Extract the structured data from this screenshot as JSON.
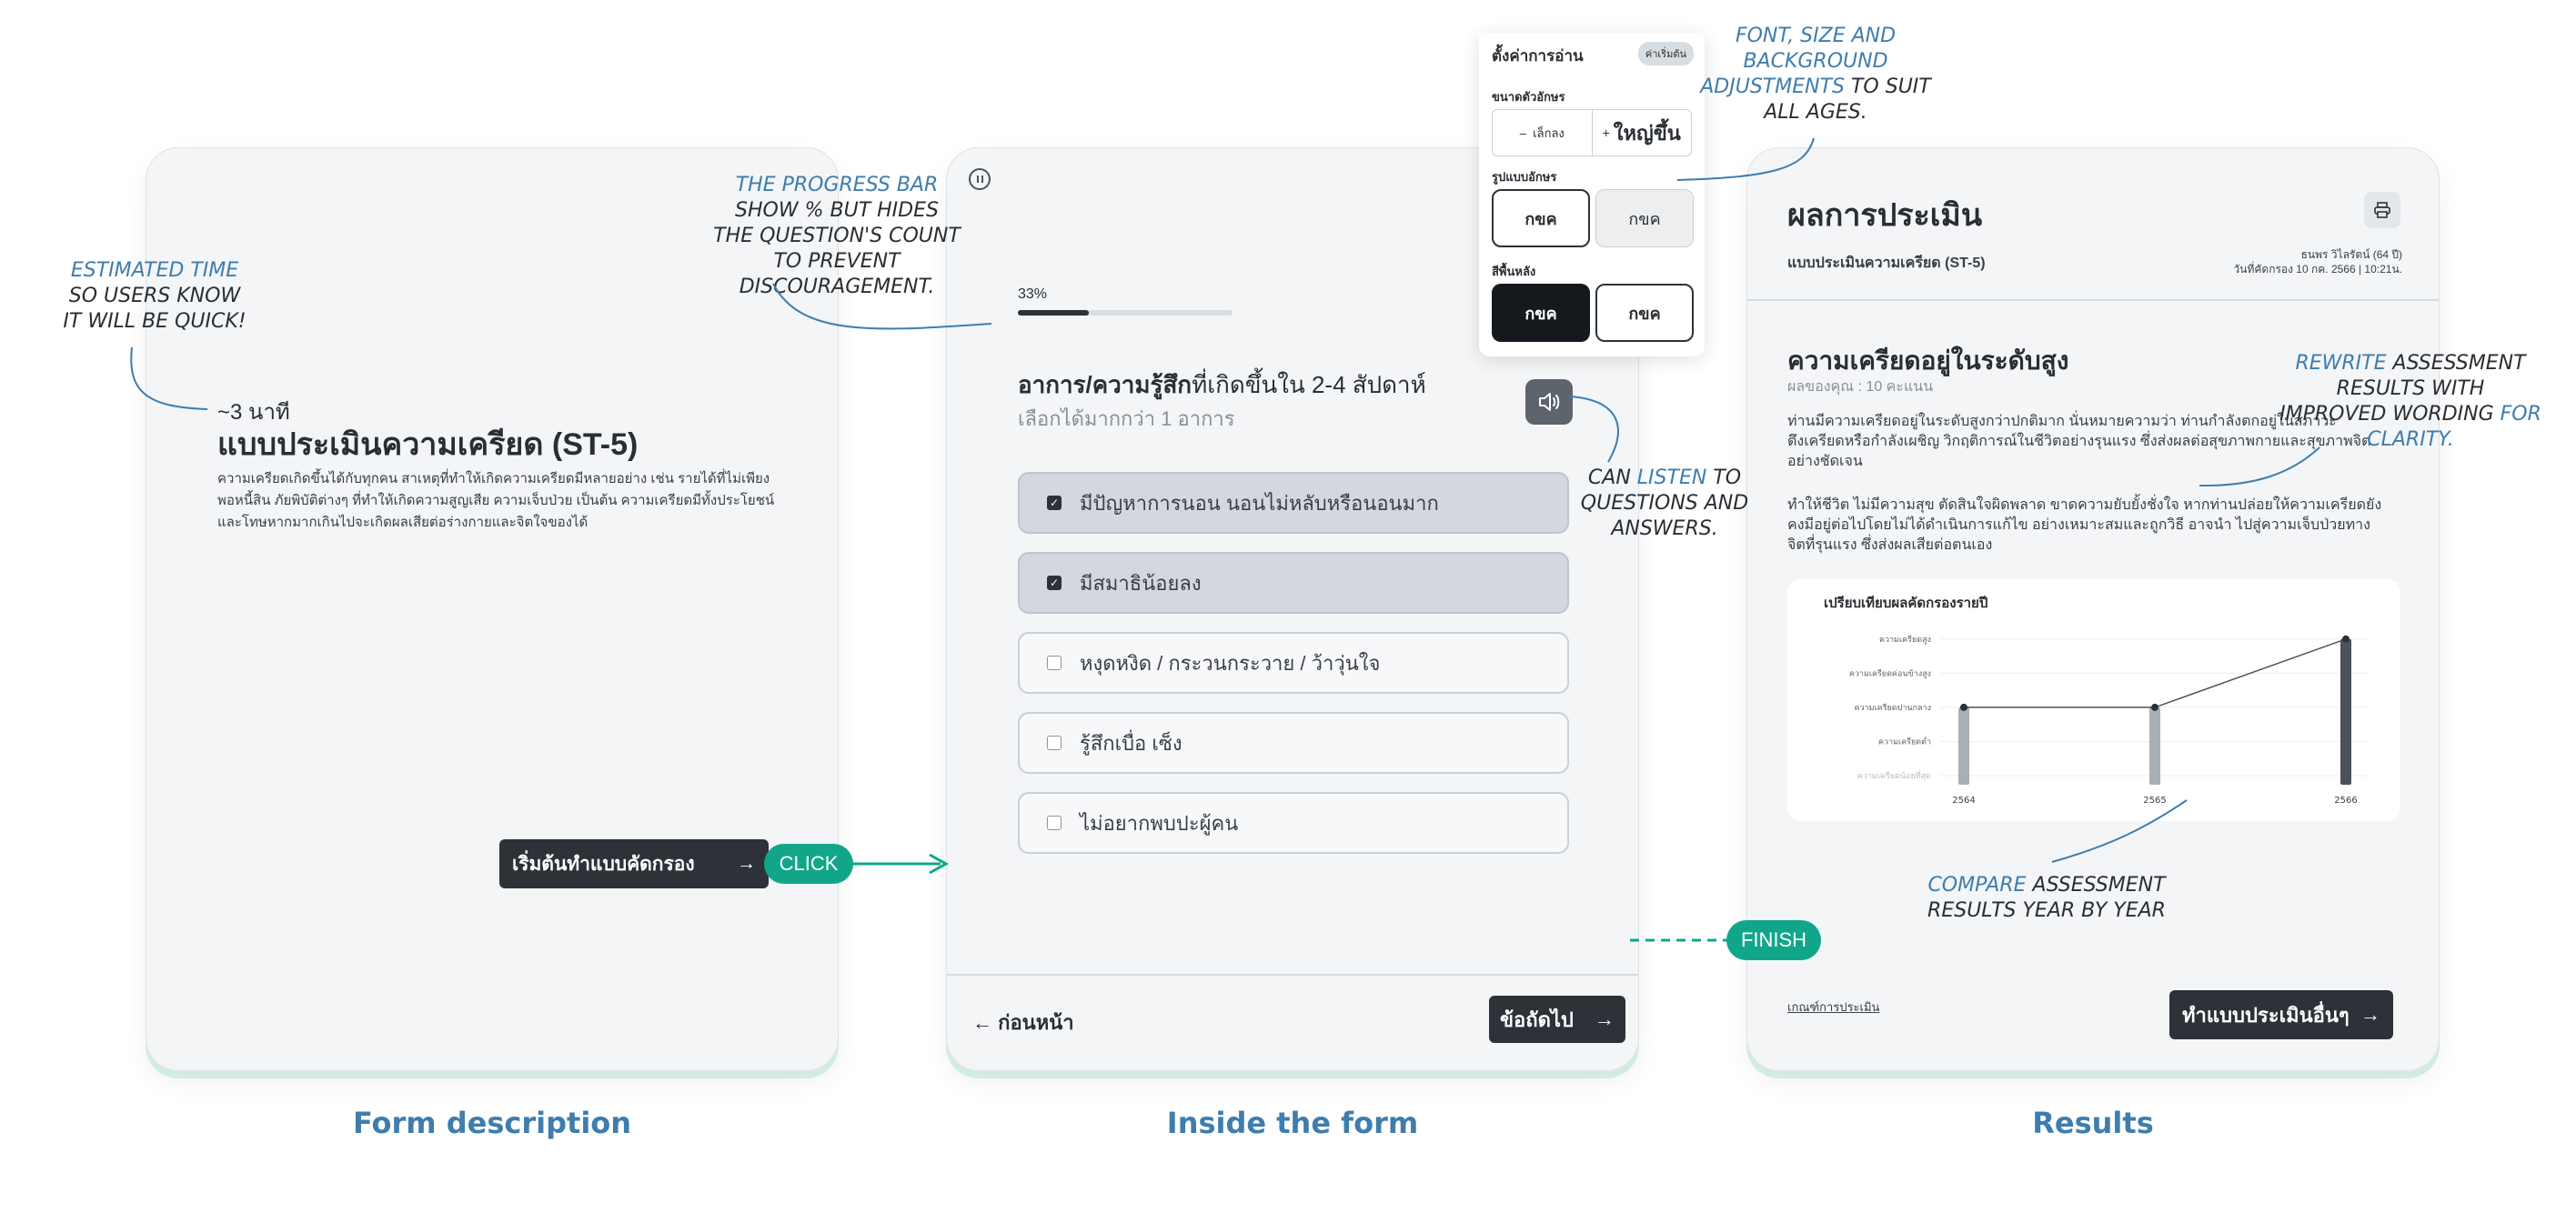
{
  "captions": {
    "description": "Form description",
    "inside": "Inside the form",
    "results": "Results"
  },
  "annotations": {
    "estimated_time": [
      "ESTIMATED TIME",
      "SO USERS KNOW",
      "IT WILL BE QUICK!"
    ],
    "progress_bar": [
      "THE PROGRESS BAR",
      "SHOW % BUT HIDES",
      "THE QUESTION'S COUNT",
      "TO PREVENT DISCOURAGEMENT."
    ],
    "font_size": [
      "FONT, SIZE AND",
      "BACKGROUND",
      "ADJUSTMENTS",
      "TO SUIT",
      "ALL AGES."
    ],
    "listen": [
      "CAN",
      "LISTEN",
      "TO",
      "QUESTIONS AND",
      "ANSWERS."
    ],
    "rewrite": [
      "REWRITE",
      "ASSESSMENT",
      "RESULTS WITH",
      "IMPROVED WORDING",
      "FOR",
      "CLARITY."
    ],
    "compare": [
      "COMPARE",
      "ASSESSMENT",
      "RESULTS YEAR BY YEAR"
    ],
    "click": "CLICK",
    "finish": "FINISH"
  },
  "description_panel": {
    "estimated_time": "~3 นาที",
    "title": "แบบประเมินความเครียด (ST-5)",
    "body": "ความเครียดเกิดขึ้นได้กับทุกคน สาเหตุที่ทำให้เกิดความเครียดมีหลายอย่าง เช่น รายได้ที่ไม่เพียงพอหนี้สิน ภัยพิบัติต่างๆ ที่ทำให้เกิดความสูญเสีย ความเจ็บป่วย เป็นต้น ความเครียดมีทั้งประโยชน์และโทษหากมากเกินไปจะเกิดผลเสียต่อร่างกายและจิตใจของได้",
    "start_button": "เริ่มต้นทำแบบคัดกรอง"
  },
  "form_panel": {
    "progress_label": "33%",
    "progress": 0.33,
    "question_bold": "อาการ/ความรู้สึก",
    "question_rest": "ที่เกิดขึ้นใน 2-4 สัปดาห์",
    "question_sub": "เลือกได้มากกว่า 1 อาการ",
    "options": [
      {
        "label": "มีปัญหาการนอน นอนไม่หลับหรือนอนมาก",
        "checked": true
      },
      {
        "label": "มีสมาธิน้อยลง",
        "checked": true
      },
      {
        "label": "หงุดหงิด / กระวนกระวาย / ว้าวุ่นใจ",
        "checked": false
      },
      {
        "label": "รู้สึกเบื่อ เซ็ง",
        "checked": false
      },
      {
        "label": "ไม่อยากพบปะผู้คน",
        "checked": false
      }
    ],
    "prev_button": "ก่อนหน้า",
    "next_button": "ข้อถัดไป"
  },
  "settings": {
    "title": "ตั้งค่าการอ่าน",
    "reset": "ค่าเริ่มต้น",
    "size_label": "ขนาดตัวอักษร",
    "smaller": "เล็กลง",
    "larger": "ใหญ่ขึ้น",
    "font_label": "รูปแบบอักษร",
    "font_options": [
      "กขค",
      "กขค"
    ],
    "bg_label": "สีพื้นหลัง",
    "bg_options": [
      "กขค",
      "กขค"
    ]
  },
  "results_panel": {
    "title": "ผลการประเมิน",
    "form_name": "แบบประเมินความเครียด (ST-5)",
    "user": "ธนพร วิไลรัตน์ (64 ปี)",
    "date": "วันที่คัดกรอง 10 กค. 2566 | 10:21น.",
    "level": "ความเครียดอยู่ในระดับสูง",
    "score": "ผลของคุณ : 10 คะแนน",
    "para1": "ท่านมีความเครียดอยู่ในระดับสูงกว่าปกติมาก นั่นหมายความว่า ท่านกำลังตกอยู่ในสภาวะตึงเครียดหรือกำลังเผชิญ วิกฤติการณ์ในชีวิตอย่างรุนแรง ซึ่งส่งผลต่อสุขภาพกายและสุขภาพจิตอย่างชัดเจน",
    "para2": "ทำให้ชีวิต ไม่มีความสุข ตัดสินใจผิดพลาด ขาดความยับยั้งชั่งใจ หากท่านปล่อยให้ความเครียดยังคงมีอยู่ต่อไปโดยไม่ได้ดำเนินการแก้ไข อย่างเหมาะสมและถูกวิธี อาจนำ ไปสู่ความเจ็บป่วยทางจิตที่รุนแรง ซึ่งส่งผลเสียต่อตนเอง",
    "criteria_link": "เกณฑ์การประเมิน",
    "other_button": "ทำแบบประเมินอื่นๆ"
  },
  "chart_data": {
    "type": "line",
    "title": "เปรียบเทียบผลคัดกรองรายปี",
    "categories": [
      "2564",
      "2565",
      "2566"
    ],
    "levels": [
      "ความเครียดน้อยที่สุด",
      "ความเครียดต่ำ",
      "ความเครียดปานกลาง",
      "ความเครียดค่อนข้างสูง",
      "ความเครียดสูง"
    ],
    "values": [
      2,
      2,
      4
    ],
    "ylim": [
      0,
      4
    ]
  },
  "colors": {
    "accent": "#11a68a",
    "dark": "#2d3138",
    "caption": "#3f7dad",
    "panel": "#f3f5f7"
  }
}
